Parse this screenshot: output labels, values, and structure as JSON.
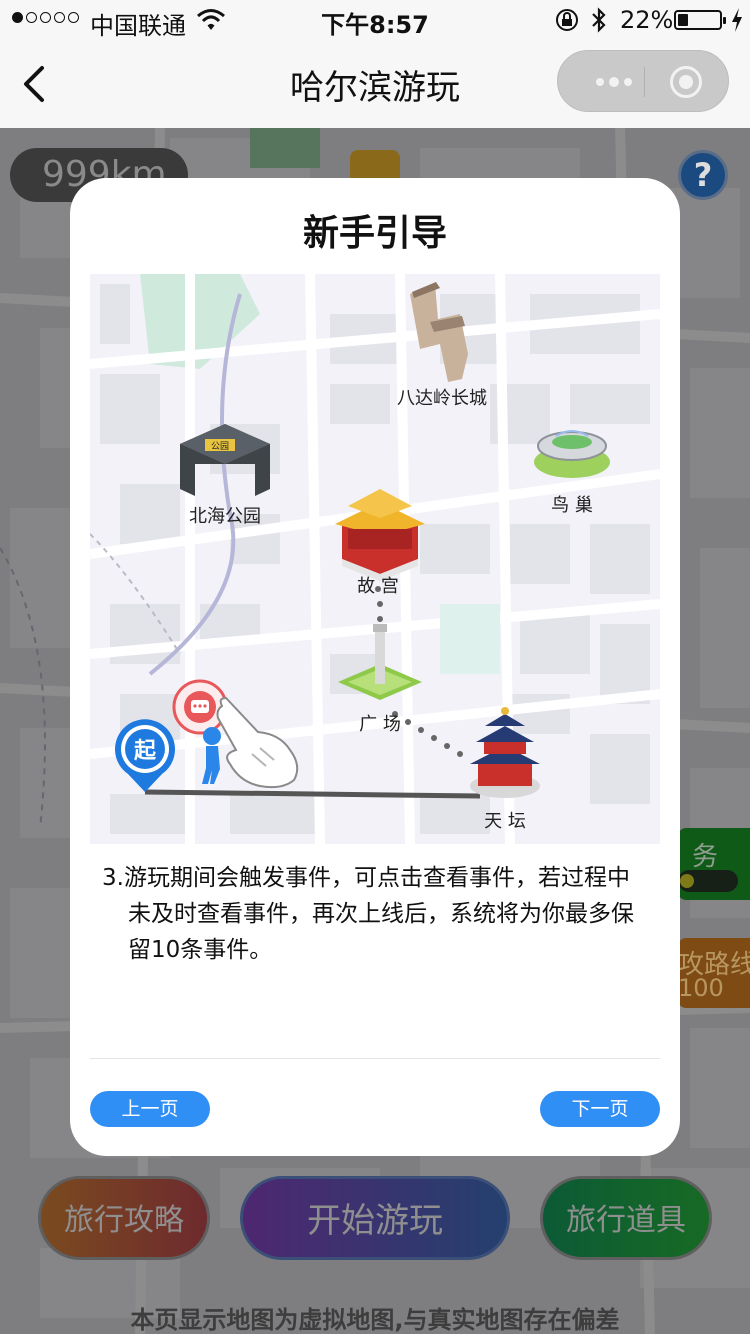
{
  "status_bar": {
    "carrier": "中国联通",
    "time": "下午8:57",
    "battery": "22%",
    "battery_level": 0.22,
    "signal_bars_filled": 1,
    "signal_bars_total": 5
  },
  "nav": {
    "title": "哈尔滨游玩"
  },
  "background": {
    "distance": "999km",
    "help_glyph": "?",
    "task_label": "务",
    "route_label_1": "攻路线",
    "route_label_2": "100",
    "buttons": {
      "guide": "旅行攻略",
      "start": "开始游玩",
      "items": "旅行道具"
    },
    "disclaimer": "本页显示地图为虚拟地图,与真实地图存在偏差"
  },
  "modal": {
    "title": "新手引导",
    "map_labels": {
      "great_wall": "八达岭长城",
      "beihai": "北海公园",
      "birds_nest": "鸟 巢",
      "palace": "故 宫",
      "square": "广 场",
      "temple": "天 坛",
      "start_marker": "起",
      "beihai_sign": "公园"
    },
    "body": "3.游玩期间会触发事件，可点击查看事件，若过程中未及时查看事件，再次上线后，系统将为你最多保留10条事件。",
    "prev_label": "上一页",
    "next_label": "下一页"
  },
  "colors": {
    "accent_blue": "#2f8ff5",
    "start_marker_blue": "#1f7ae0",
    "event_red": "#e8585a"
  },
  "icons": [
    "signal-dots-icon",
    "wifi-icon",
    "lock-rotation-icon",
    "bluetooth-icon",
    "battery-icon",
    "charging-bolt-icon",
    "back-chevron-icon",
    "more-dots-icon",
    "close-target-icon",
    "help-icon",
    "weather-sun-icon",
    "hand-pointer-icon",
    "event-bubble-icon",
    "start-pin-icon"
  ]
}
